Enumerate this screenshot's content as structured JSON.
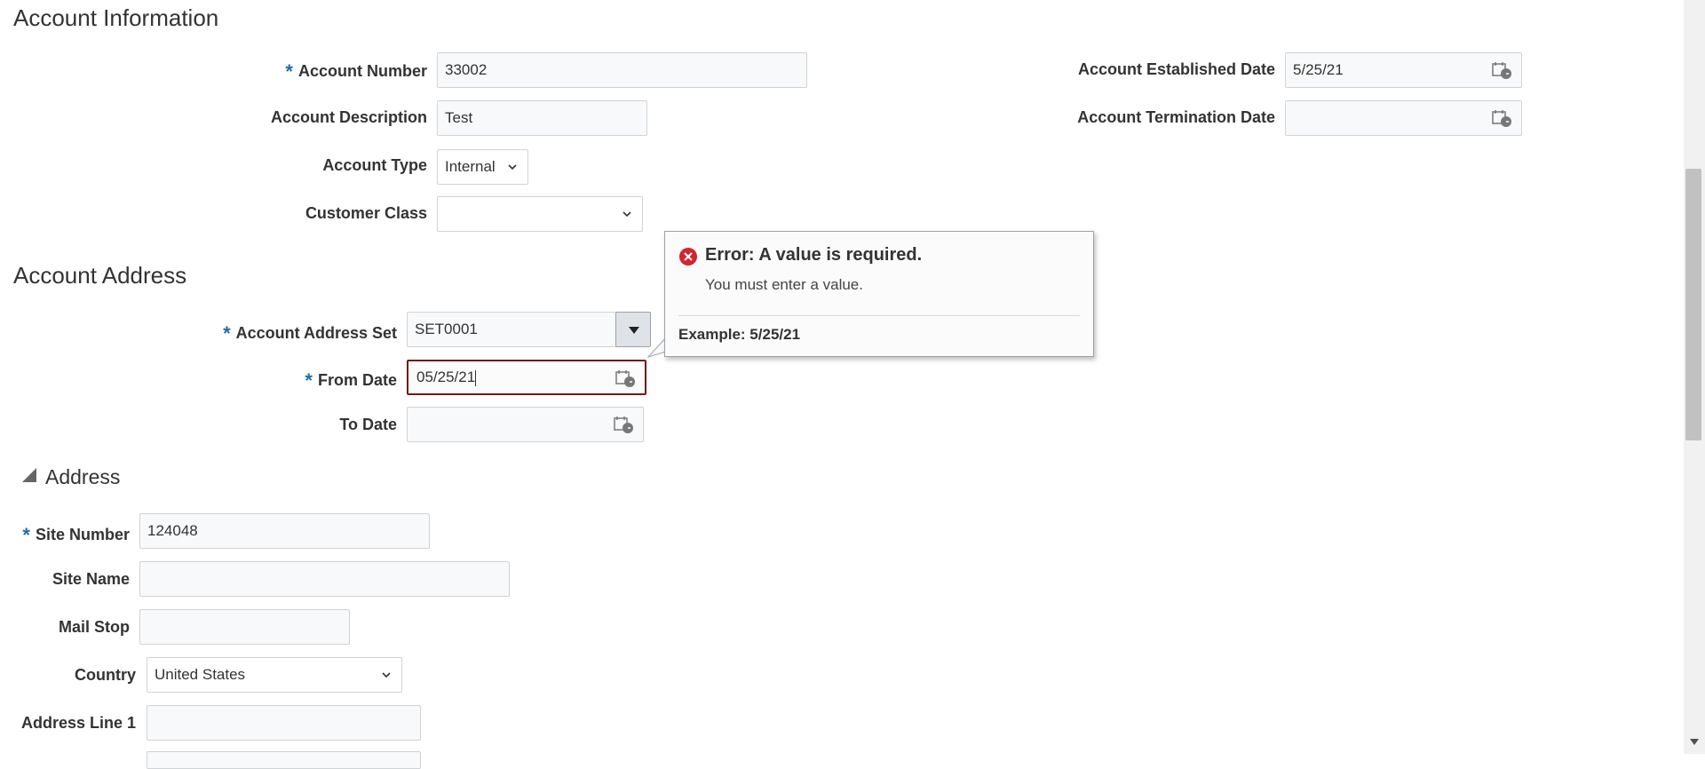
{
  "account_info": {
    "title": "Account Information",
    "account_number": {
      "label": "Account Number",
      "value": "33002"
    },
    "account_description": {
      "label": "Account Description",
      "value": "Test"
    },
    "account_type": {
      "label": "Account Type",
      "value": "Internal"
    },
    "customer_class": {
      "label": "Customer Class",
      "value": ""
    },
    "established_date": {
      "label": "Account Established Date",
      "value": "5/25/21"
    },
    "termination_date": {
      "label": "Account Termination Date",
      "value": ""
    }
  },
  "account_address": {
    "title": "Account Address",
    "address_set": {
      "label": "Account Address Set",
      "value": "SET0001"
    },
    "from_date": {
      "label": "From Date",
      "value": "05/25/21"
    },
    "to_date": {
      "label": "To Date",
      "value": ""
    }
  },
  "error_popup": {
    "title": "Error: A value is required.",
    "message": "You must enter a value.",
    "example": "Example: 5/25/21"
  },
  "address": {
    "title": "Address",
    "site_number": {
      "label": "Site Number",
      "value": "124048"
    },
    "site_name": {
      "label": "Site Name",
      "value": ""
    },
    "mail_stop": {
      "label": "Mail Stop",
      "value": ""
    },
    "country": {
      "label": "Country",
      "value": "United States"
    },
    "address_line_1": {
      "label": "Address Line 1",
      "value": ""
    }
  },
  "required_marker": "*",
  "icons": {
    "calendar": "calendar-icon",
    "dropdown": "chevron-down-icon",
    "error": "error-icon",
    "collapse": "collapse-triangle-icon"
  },
  "colors": {
    "required": "#1f6cb0",
    "error_icon": "#d6232e",
    "error_border": "#6f1b1b"
  }
}
